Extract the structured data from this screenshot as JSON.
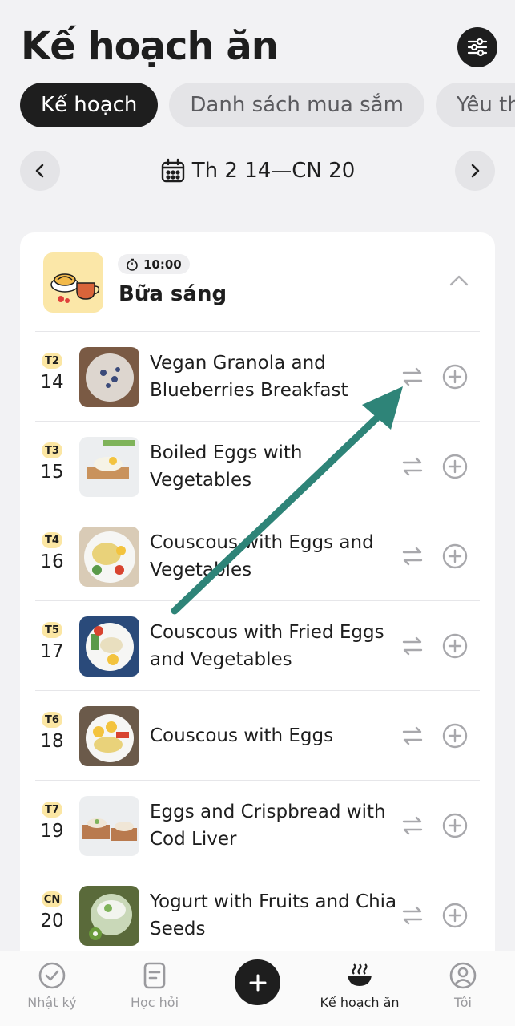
{
  "page": {
    "title": "Kế hoạch ăn"
  },
  "tabs": [
    {
      "label": "Kế hoạch",
      "active": true
    },
    {
      "label": "Danh sách mua sắm",
      "active": false
    },
    {
      "label": "Yêu thí",
      "active": false
    }
  ],
  "week": {
    "label": "Th 2 14—CN 20",
    "prev_icon": "chevron-left-icon",
    "next_icon": "chevron-right-icon",
    "calendar_icon": "calendar-icon"
  },
  "meal": {
    "time": "10:00",
    "name": "Bữa sáng",
    "timer_icon": "stopwatch-icon"
  },
  "days": [
    {
      "tag": "T2",
      "day": "14",
      "recipe": "Vegan Granola and Blueberries Breakfast"
    },
    {
      "tag": "T3",
      "day": "15",
      "recipe": "Boiled Eggs with Vegetables"
    },
    {
      "tag": "T4",
      "day": "16",
      "recipe": "Couscous with Eggs and Vegetables"
    },
    {
      "tag": "T5",
      "day": "17",
      "recipe": "Couscous with Fried Eggs and Vegetables"
    },
    {
      "tag": "T6",
      "day": "18",
      "recipe": "Couscous with Eggs"
    },
    {
      "tag": "T7",
      "day": "19",
      "recipe": "Eggs and Crispbread with Cod Liver"
    },
    {
      "tag": "CN",
      "day": "20",
      "recipe": "Yogurt with Fruits and Chia Seeds"
    }
  ],
  "bottom_nav": [
    {
      "label": "Nhật ký",
      "icon": "check-circle-icon"
    },
    {
      "label": "Học hỏi",
      "icon": "document-icon"
    },
    {
      "label": "Kế hoạch ăn",
      "icon": "bowl-icon",
      "active": true
    },
    {
      "label": "Tôi",
      "icon": "profile-icon"
    }
  ],
  "colors": {
    "accent_dark": "#1e1e1e",
    "day_tag": "#fbe6a3",
    "annotation_arrow": "#2e8478"
  }
}
